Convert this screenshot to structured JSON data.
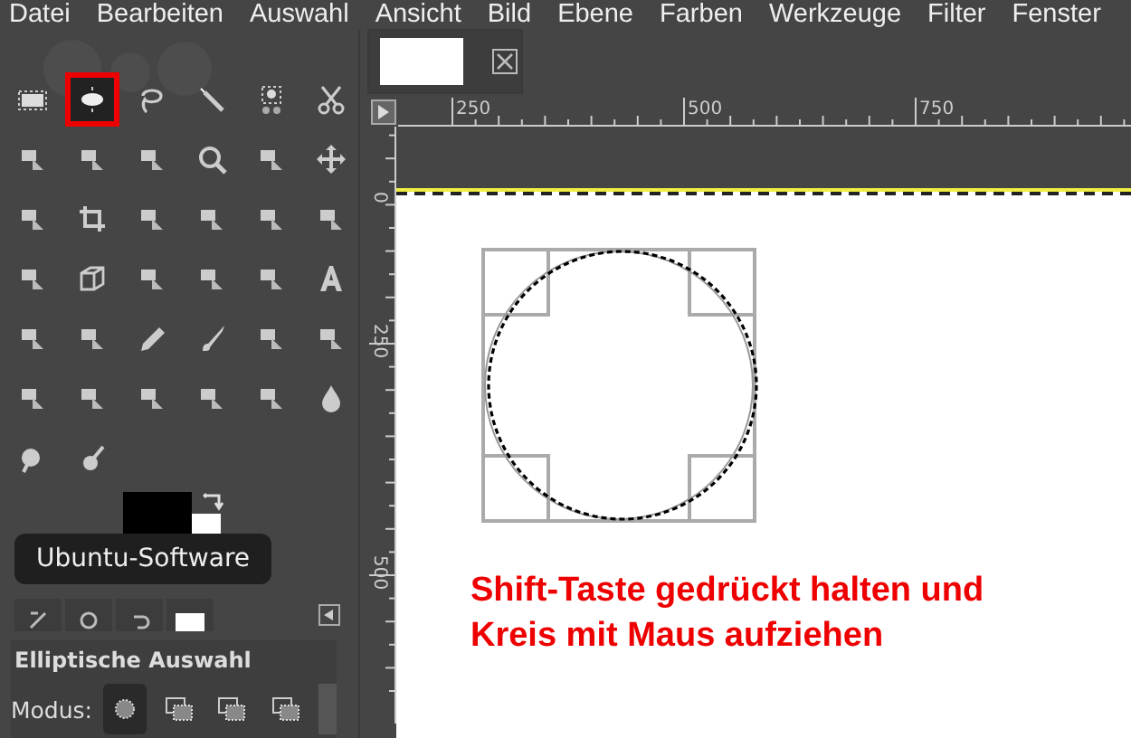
{
  "menu_bar": {
    "items": [
      "Datei",
      "Bearbeiten",
      "Auswahl",
      "Ansicht",
      "Bild",
      "Ebene",
      "Farben",
      "Werkzeuge",
      "Filter",
      "Fenster"
    ]
  },
  "toolbox": {
    "tools": [
      {
        "kind": "rect-select",
        "selected": false
      },
      {
        "kind": "ellipse-select",
        "selected": true
      },
      {
        "kind": "lasso",
        "selected": false
      },
      {
        "kind": "wand",
        "selected": false
      },
      {
        "kind": "color-select",
        "selected": false
      },
      {
        "kind": "scissors",
        "selected": false
      },
      {
        "kind": "foreground-select",
        "selected": false
      },
      {
        "kind": "paths",
        "selected": false
      },
      {
        "kind": "picker",
        "selected": false
      },
      {
        "kind": "zoom",
        "selected": false
      },
      {
        "kind": "measure",
        "selected": false
      },
      {
        "kind": "move",
        "selected": false
      },
      {
        "kind": "align",
        "selected": false
      },
      {
        "kind": "crop",
        "selected": false
      },
      {
        "kind": "transform",
        "selected": false
      },
      {
        "kind": "rotate",
        "selected": false
      },
      {
        "kind": "scale",
        "selected": false
      },
      {
        "kind": "shear",
        "selected": false
      },
      {
        "kind": "perspective",
        "selected": false
      },
      {
        "kind": "cube",
        "selected": false
      },
      {
        "kind": "flip",
        "selected": false
      },
      {
        "kind": "cage",
        "selected": false
      },
      {
        "kind": "warp",
        "selected": false
      },
      {
        "kind": "text",
        "selected": false
      },
      {
        "kind": "bucket",
        "selected": false
      },
      {
        "kind": "blend",
        "selected": false
      },
      {
        "kind": "pencil",
        "selected": false
      },
      {
        "kind": "brush",
        "selected": false
      },
      {
        "kind": "eraser",
        "selected": false
      },
      {
        "kind": "airbrush",
        "selected": false
      },
      {
        "kind": "ink",
        "selected": false
      },
      {
        "kind": "mypaint",
        "selected": false
      },
      {
        "kind": "clone",
        "selected": false
      },
      {
        "kind": "heal",
        "selected": false
      },
      {
        "kind": "stamp",
        "selected": false
      },
      {
        "kind": "blur",
        "selected": false
      },
      {
        "kind": "smudge",
        "selected": false
      },
      {
        "kind": "dodge",
        "selected": false
      }
    ],
    "foreground": {
      "color": "#000000"
    },
    "background": {
      "color": "#ffffff"
    }
  },
  "tooltip": {
    "text": "Ubuntu-Software"
  },
  "tool_options": {
    "title": "Elliptische Auswahl",
    "mode_label": "Modus:",
    "modes": [
      {
        "selected": true
      },
      {
        "selected": false
      },
      {
        "selected": false
      },
      {
        "selected": false
      }
    ]
  },
  "dock_tabs": [
    {
      "kind": "options"
    },
    {
      "kind": "device"
    },
    {
      "kind": "undo"
    },
    {
      "kind": "images"
    }
  ],
  "rulers": {
    "horizontal": [
      "250",
      "500",
      "750"
    ],
    "vertical": [
      "0",
      "250",
      "500"
    ]
  },
  "annotation": {
    "lines": [
      "Shift-Taste gedrückt halten und",
      "Kreis mit Maus aufziehen"
    ]
  }
}
